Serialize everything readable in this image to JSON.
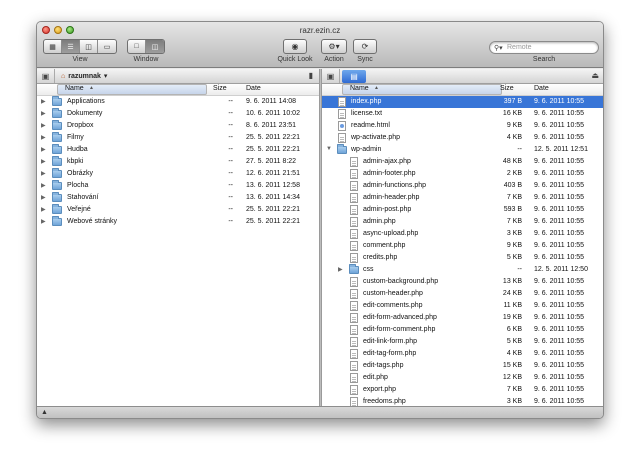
{
  "window": {
    "title": "razr.ezin.cz"
  },
  "toolbar": {
    "view_label": "View",
    "window_label": "Window",
    "quicklook_label": "Quick Look",
    "action_label": "Action",
    "sync_label": "Sync",
    "search_label": "Search",
    "search_placeholder": "Remote"
  },
  "left_pane": {
    "breadcrumb": "razumnak",
    "columns": {
      "name": "Name",
      "size": "Size",
      "date": "Date"
    },
    "rows": [
      {
        "name": "Applications",
        "size": "--",
        "date": "9. 6. 2011 14:08"
      },
      {
        "name": "Dokumenty",
        "size": "--",
        "date": "10. 6. 2011 10:02"
      },
      {
        "name": "Dropbox",
        "size": "--",
        "date": "8. 6. 2011 23:51"
      },
      {
        "name": "Filmy",
        "size": "--",
        "date": "25. 5. 2011 22:21"
      },
      {
        "name": "Hudba",
        "size": "--",
        "date": "25. 5. 2011 22:21"
      },
      {
        "name": "kbpki",
        "size": "--",
        "date": "27. 5. 2011 8:22"
      },
      {
        "name": "Obrázky",
        "size": "--",
        "date": "12. 6. 2011 21:51"
      },
      {
        "name": "Plocha",
        "size": "--",
        "date": "13. 6. 2011 12:58"
      },
      {
        "name": "Stahování",
        "size": "--",
        "date": "13. 6. 2011 14:34"
      },
      {
        "name": "Veřejné",
        "size": "--",
        "date": "25. 5. 2011 22:21"
      },
      {
        "name": "Webové stránky",
        "size": "--",
        "date": "25. 5. 2011 22:21"
      }
    ]
  },
  "right_pane": {
    "columns": {
      "name": "Name",
      "size": "Size",
      "date": "Date"
    },
    "rows": [
      {
        "name": "index.php",
        "size": "397 B",
        "date": "9. 6. 2011 10:55",
        "kind": "file",
        "level": 0,
        "selected": true
      },
      {
        "name": "license.txt",
        "size": "16 KB",
        "date": "9. 6. 2011 10:55",
        "kind": "file",
        "level": 0
      },
      {
        "name": "readme.html",
        "size": "9 KB",
        "date": "9. 6. 2011 10:55",
        "kind": "html",
        "level": 0
      },
      {
        "name": "wp-activate.php",
        "size": "4 KB",
        "date": "9. 6. 2011 10:55",
        "kind": "file",
        "level": 0
      },
      {
        "name": "wp-admin",
        "size": "--",
        "date": "12. 5. 2011 12:51",
        "kind": "folder",
        "level": 0,
        "expanded": true
      },
      {
        "name": "admin-ajax.php",
        "size": "48 KB",
        "date": "9. 6. 2011 10:55",
        "kind": "file",
        "level": 1
      },
      {
        "name": "admin-footer.php",
        "size": "2 KB",
        "date": "9. 6. 2011 10:55",
        "kind": "file",
        "level": 1
      },
      {
        "name": "admin-functions.php",
        "size": "403 B",
        "date": "9. 6. 2011 10:55",
        "kind": "file",
        "level": 1
      },
      {
        "name": "admin-header.php",
        "size": "7 KB",
        "date": "9. 6. 2011 10:55",
        "kind": "file",
        "level": 1
      },
      {
        "name": "admin-post.php",
        "size": "593 B",
        "date": "9. 6. 2011 10:55",
        "kind": "file",
        "level": 1
      },
      {
        "name": "admin.php",
        "size": "7 KB",
        "date": "9. 6. 2011 10:55",
        "kind": "file",
        "level": 1
      },
      {
        "name": "async-upload.php",
        "size": "3 KB",
        "date": "9. 6. 2011 10:55",
        "kind": "file",
        "level": 1
      },
      {
        "name": "comment.php",
        "size": "9 KB",
        "date": "9. 6. 2011 10:55",
        "kind": "file",
        "level": 1
      },
      {
        "name": "credits.php",
        "size": "5 KB",
        "date": "9. 6. 2011 10:55",
        "kind": "file",
        "level": 1
      },
      {
        "name": "css",
        "size": "--",
        "date": "12. 5. 2011 12:50",
        "kind": "folder",
        "level": 1
      },
      {
        "name": "custom-background.php",
        "size": "13 KB",
        "date": "9. 6. 2011 10:55",
        "kind": "file",
        "level": 1
      },
      {
        "name": "custom-header.php",
        "size": "24 KB",
        "date": "9. 6. 2011 10:55",
        "kind": "file",
        "level": 1
      },
      {
        "name": "edit-comments.php",
        "size": "11 KB",
        "date": "9. 6. 2011 10:55",
        "kind": "file",
        "level": 1
      },
      {
        "name": "edit-form-advanced.php",
        "size": "19 KB",
        "date": "9. 6. 2011 10:55",
        "kind": "file",
        "level": 1
      },
      {
        "name": "edit-form-comment.php",
        "size": "6 KB",
        "date": "9. 6. 2011 10:55",
        "kind": "file",
        "level": 1
      },
      {
        "name": "edit-link-form.php",
        "size": "5 KB",
        "date": "9. 6. 2011 10:55",
        "kind": "file",
        "level": 1
      },
      {
        "name": "edit-tag-form.php",
        "size": "4 KB",
        "date": "9. 6. 2011 10:55",
        "kind": "file",
        "level": 1
      },
      {
        "name": "edit-tags.php",
        "size": "15 KB",
        "date": "9. 6. 2011 10:55",
        "kind": "file",
        "level": 1
      },
      {
        "name": "edit.php",
        "size": "12 KB",
        "date": "9. 6. 2011 10:55",
        "kind": "file",
        "level": 1
      },
      {
        "name": "export.php",
        "size": "7 KB",
        "date": "9. 6. 2011 10:55",
        "kind": "file",
        "level": 1
      },
      {
        "name": "freedoms.php",
        "size": "3 KB",
        "date": "9. 6. 2011 10:55",
        "kind": "file",
        "level": 1
      }
    ]
  },
  "icons": {
    "view_modes": [
      "icon-view-icon",
      "list-view-icon",
      "column-view-icon",
      "coverflow-view-icon"
    ],
    "window_modes": [
      "single-pane-icon",
      "dual-pane-icon"
    ],
    "quicklook": "eye-icon",
    "action": "gear-icon",
    "sync": "sync-icon",
    "search": "search-icon"
  },
  "colors": {
    "selection": "#3875d7"
  }
}
